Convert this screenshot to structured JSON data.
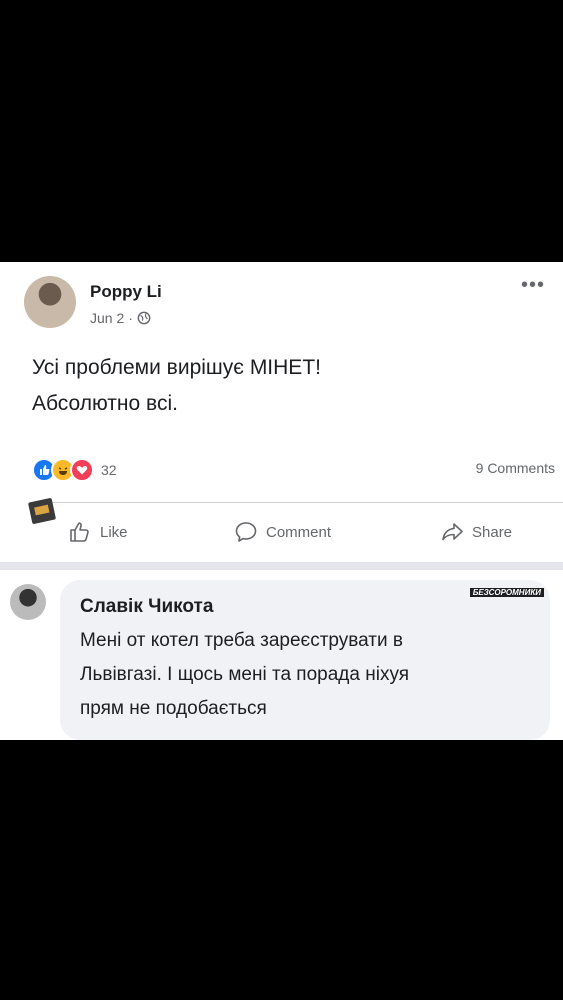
{
  "post": {
    "author": "Poppy Li",
    "date": "Jun 2",
    "separator_dot": "·",
    "privacy_icon": "globe-icon",
    "more_label": "•••",
    "text": "Усі проблеми вирішує МІНЕТ!\nАбсолютно всі.",
    "reactions": {
      "icons": [
        "like-reaction-icon",
        "haha-reaction-icon",
        "love-reaction-icon"
      ],
      "count": "32"
    },
    "comments_count": "9 Comments"
  },
  "actions": {
    "like": "Like",
    "comment": "Comment",
    "share": "Share"
  },
  "comment": {
    "author": "Славік Чикота",
    "text": "Мені от котел треба зареєструвати в\nЛьвівгазі. І щось мені та порада ніхуя\nпрям не подобається",
    "watermark": "БЕЗСОРОМНИКИ"
  },
  "colors": {
    "like_blue": "#1877f2",
    "haha_yellow": "#f7b928",
    "love_red": "#f33e58",
    "meta_gray": "#65676b",
    "bubble_gray": "#f0f2f5"
  }
}
